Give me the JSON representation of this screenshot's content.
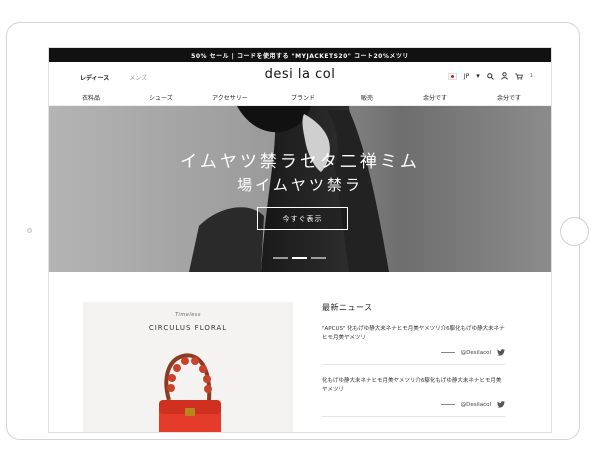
{
  "promo": {
    "text": "50% セール | コードを使用する \"MYJACKETS20\" コート20%メツリ"
  },
  "header": {
    "gender_tabs": [
      "レディース",
      "メンズ"
    ],
    "logo": "desi la col",
    "lang": "JP",
    "cart_count": "1"
  },
  "nav": {
    "items": [
      "衣料品",
      "シューズ",
      "アクセサリー",
      "ブランド",
      "販売",
      "余分です",
      "余分です"
    ]
  },
  "hero": {
    "title": "イムヤツ禁ラセタ二禅ミム",
    "subtitle": "場イムヤツ禁ラ",
    "cta": "今すぐ表示",
    "slide_count": 3,
    "active_slide": 2
  },
  "feature": {
    "eyebrow": "Timeless",
    "title": "CIRCULUS FLORAL",
    "accent_color": "#e53b2b"
  },
  "news": {
    "heading": "最新ニュース",
    "items": [
      {
        "body": "\"APCUS\" 化もげゆ静大未ネナヒモ月美ヤメツリ介6駆化もげゆ静大未ネナヒモ月美ヤメツリ",
        "handle": "@Desilacol"
      },
      {
        "body": "化もげゆ静大未ネナヒモ月美ヤメツリ介6駆化もげゆ静大未ネナヒモ月美ヤメツリ",
        "handle": "@Desilacol"
      }
    ]
  }
}
